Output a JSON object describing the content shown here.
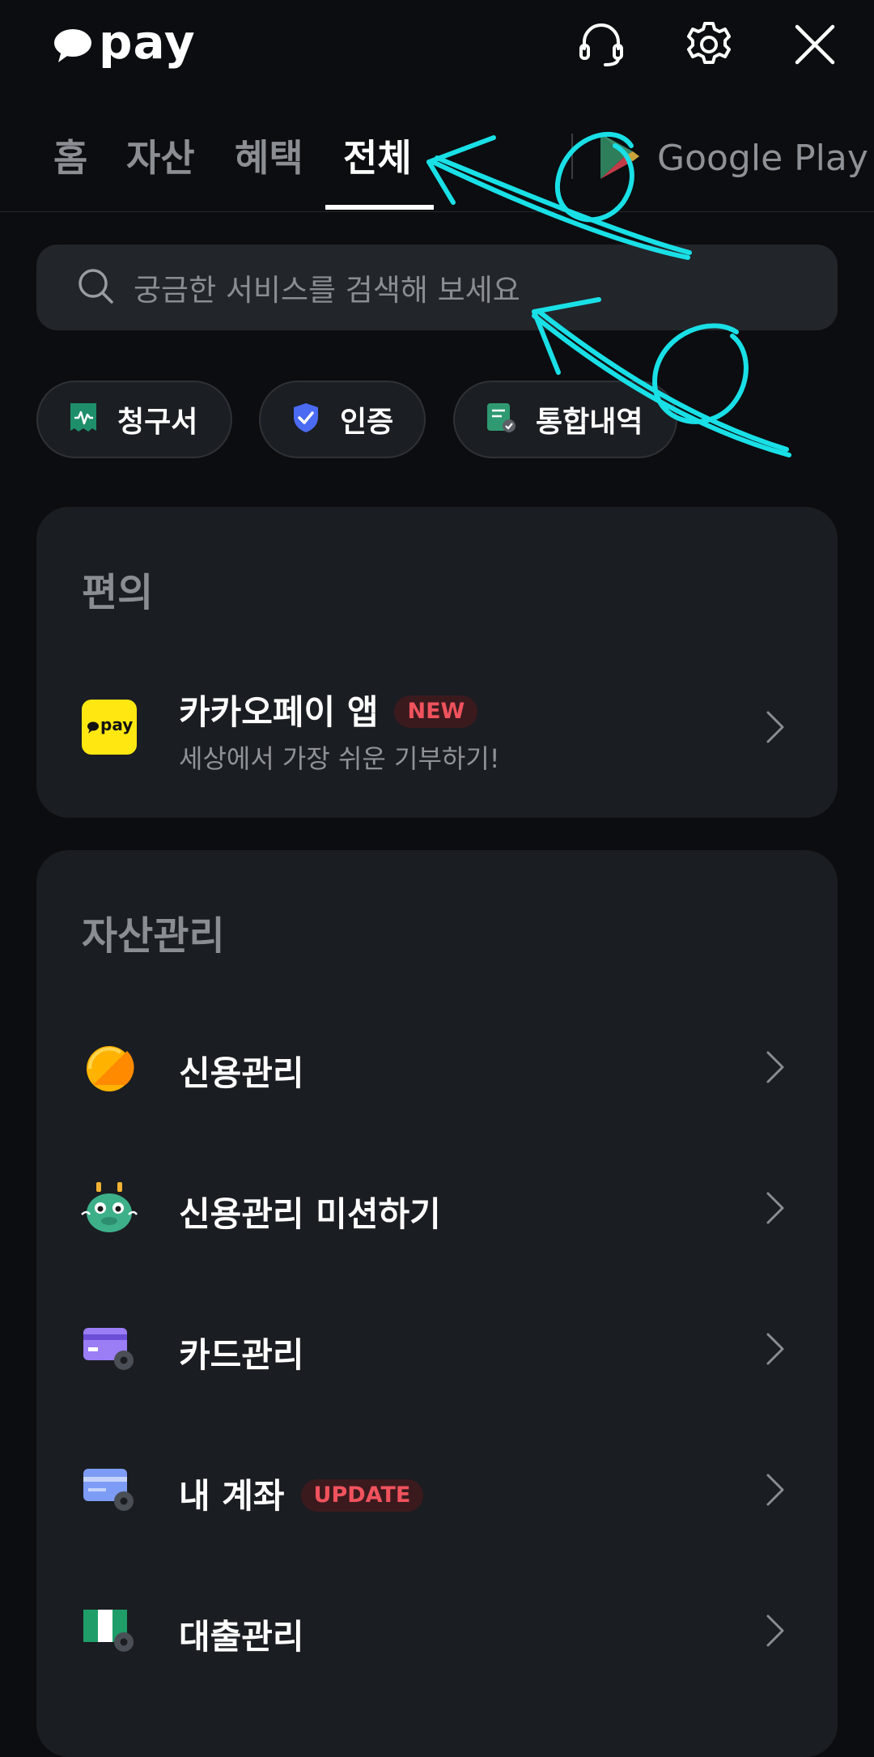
{
  "app": {
    "logo_text": "pay"
  },
  "header": {
    "support_icon": "headset-icon",
    "settings_icon": "gear-icon",
    "close_icon": "close-icon"
  },
  "tabs": [
    {
      "label": "홈",
      "active": false
    },
    {
      "label": "자산",
      "active": false
    },
    {
      "label": "혜택",
      "active": false
    },
    {
      "label": "전체",
      "active": true
    }
  ],
  "google_play": {
    "label": "Google Play"
  },
  "search": {
    "placeholder": "궁금한 서비스를 검색해 보세요"
  },
  "chips": [
    {
      "label": "청구서",
      "icon": "bill-icon"
    },
    {
      "label": "인증",
      "icon": "shield-check-icon"
    },
    {
      "label": "통합내역",
      "icon": "history-doc-icon"
    }
  ],
  "sections": {
    "convenience": {
      "title": "편의",
      "items": [
        {
          "title": "카카오페이 앱",
          "badge": "NEW",
          "subtitle": "세상에서 가장 쉬운 기부하기!",
          "icon": "kakaopay-app-icon"
        }
      ]
    },
    "asset_management": {
      "title": "자산관리",
      "items": [
        {
          "title": "신용관리",
          "icon": "credit-score-icon"
        },
        {
          "title": "신용관리 미션하기",
          "icon": "dragon-mission-icon"
        },
        {
          "title": "카드관리",
          "icon": "card-settings-icon"
        },
        {
          "title": "내 계좌",
          "badge": "UPDATE",
          "icon": "account-settings-icon"
        },
        {
          "title": "대출관리",
          "icon": "loan-settings-icon"
        }
      ]
    }
  },
  "colors": {
    "background": "#0b0d10",
    "card": "#1a1d21",
    "accent_badge": "#f0535d",
    "annotation_arrow": "#19e0e6",
    "kakao_yellow": "#ffe812"
  }
}
